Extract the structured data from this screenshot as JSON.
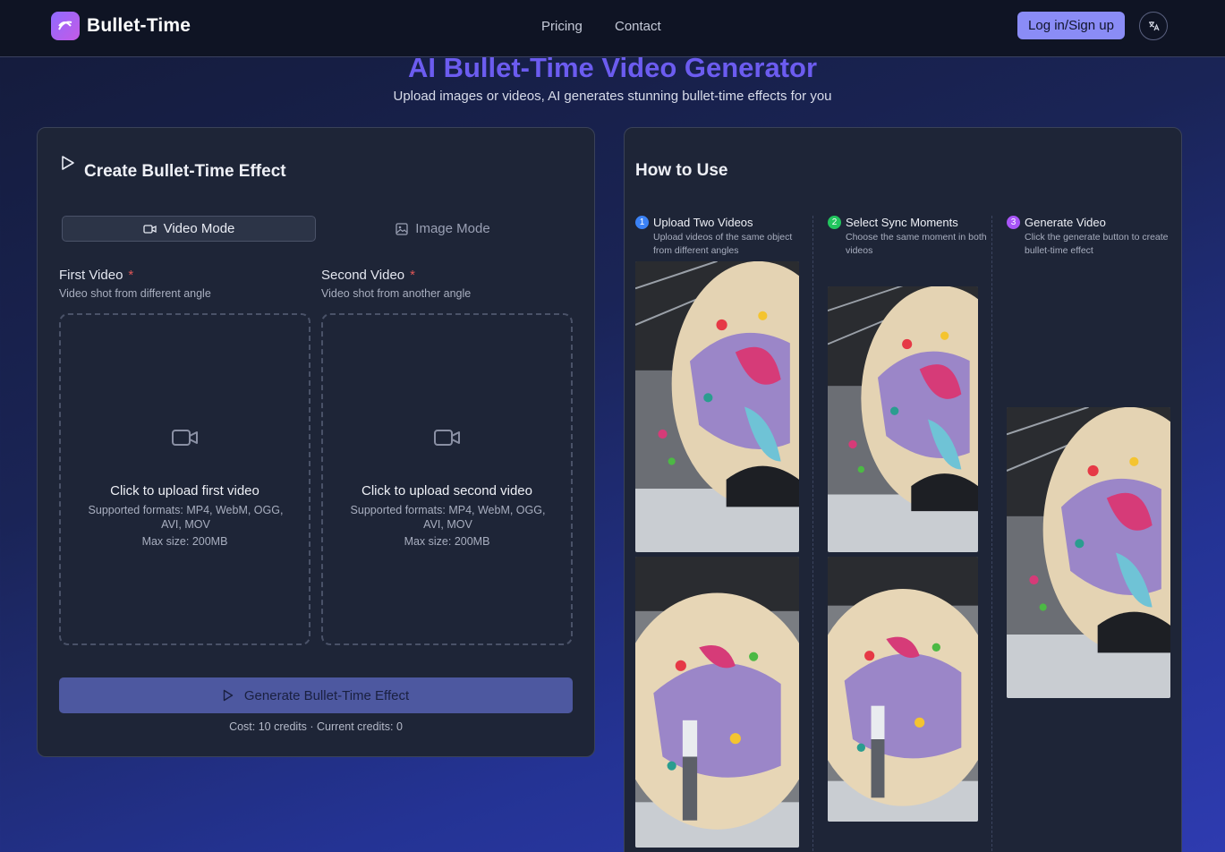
{
  "header": {
    "brand": "Bullet-Time",
    "nav": [
      "Pricing",
      "Contact"
    ],
    "login_label": "Log in/Sign up",
    "language_icon": "translate-icon"
  },
  "hero": {
    "title": "AI Bullet-Time Video Generator",
    "subtitle": "Upload images or videos, AI generates stunning bullet-time effects for you"
  },
  "create": {
    "title": "Create Bullet-Time Effect",
    "modes": [
      "Video Mode",
      "Image Mode"
    ],
    "active_mode": "Video Mode",
    "fields": [
      {
        "label": "First Video",
        "required": "*",
        "description": "Video shot from different angle",
        "upload_label": "Click to upload first video",
        "formats": "Supported formats: MP4, WebM, OGG, AVI, MOV",
        "max_size": "Max size: 200MB"
      },
      {
        "label": "Second Video",
        "required": "*",
        "description": "Video shot from another angle",
        "upload_label": "Click to upload second video",
        "formats": "Supported formats: MP4, WebM, OGG, AVI, MOV",
        "max_size": "Max size: 200MB"
      }
    ],
    "generate_label": "Generate Bullet-Time Effect",
    "cost_text": "Cost: 10 credits · Current credits: 0"
  },
  "howto": {
    "title": "How to Use",
    "steps": [
      {
        "number": "1",
        "title": "Upload Two Videos",
        "description": "Upload videos of the same object from different angles",
        "color": "#3b82f6"
      },
      {
        "number": "2",
        "title": "Select Sync Moments",
        "description": "Choose the same moment in both videos",
        "color": "#22c55e"
      },
      {
        "number": "3",
        "title": "Generate Video",
        "description": "Click the generate button to create bullet-time effect",
        "color": "#a855f7"
      }
    ]
  },
  "colors": {
    "accent": "#6c5cf0",
    "button": "#8a8cf6",
    "card": "#1e2537"
  }
}
